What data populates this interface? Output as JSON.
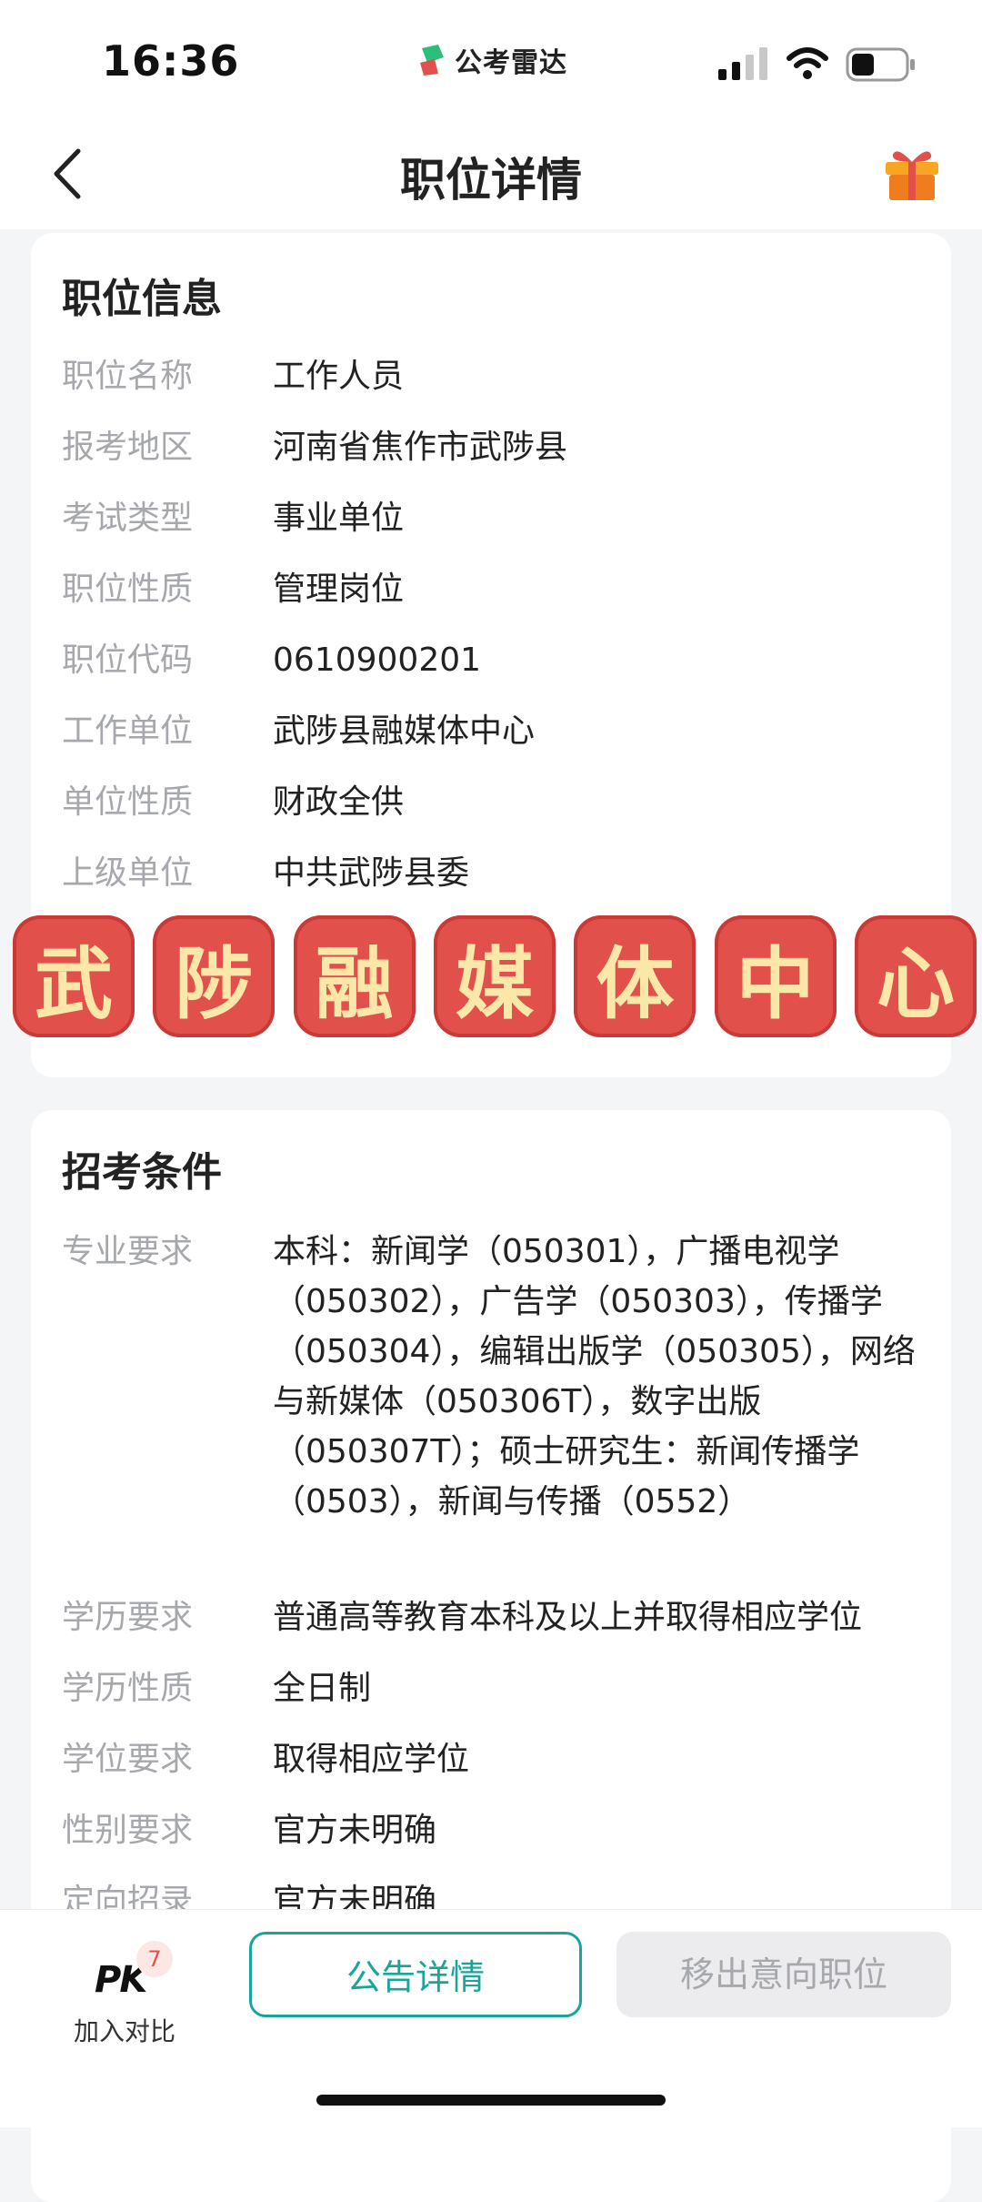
{
  "status": {
    "time": "16:36",
    "brand": "公考雷达"
  },
  "nav": {
    "title": "职位详情"
  },
  "job_info": {
    "title": "职位信息",
    "rows": [
      {
        "label": "职位名称",
        "value": "工作人员"
      },
      {
        "label": "报考地区",
        "value": "河南省焦作市武陟县"
      },
      {
        "label": "考试类型",
        "value": "事业单位"
      },
      {
        "label": "职位性质",
        "value": "管理岗位"
      },
      {
        "label": "职位代码",
        "value": "0610900201"
      },
      {
        "label": "工作单位",
        "value": "武陟县融媒体中心"
      },
      {
        "label": "单位性质",
        "value": "财政全供"
      },
      {
        "label": "上级单位",
        "value": "中共武陟县委"
      }
    ]
  },
  "stamp": {
    "chars": [
      "武",
      "陟",
      "融",
      "媒",
      "体",
      "中",
      "心"
    ]
  },
  "conditions": {
    "title": "招考条件",
    "major_label": "专业要求",
    "major_value": "本科：新闻学（050301），广播电视学（050302），广告学（050303），传播学（050304），编辑出版学（050305），网络与新媒体（050306T），数字出版（050307T）；硕士研究生：新闻传播学（0503），新闻与传播（0552）",
    "rows": [
      {
        "label": "学历要求",
        "value": "普通高等教育本科及以上并取得相应学位"
      },
      {
        "label": "学历性质",
        "value": "全日制"
      },
      {
        "label": "学位要求",
        "value": "取得相应学位"
      },
      {
        "label": "性别要求",
        "value": "官方未明确"
      },
      {
        "label": "定向招录",
        "value": "官方未明确"
      }
    ]
  },
  "bottom": {
    "pk_logo": "PK",
    "pk_count": "7",
    "pk_label": "加入对比",
    "notice_button": "公告详情",
    "remove_button": "移出意向职位"
  },
  "colors": {
    "accent": "#1aa59a",
    "stamp_red": "#e2504b",
    "stamp_text": "#fbe7a8"
  }
}
